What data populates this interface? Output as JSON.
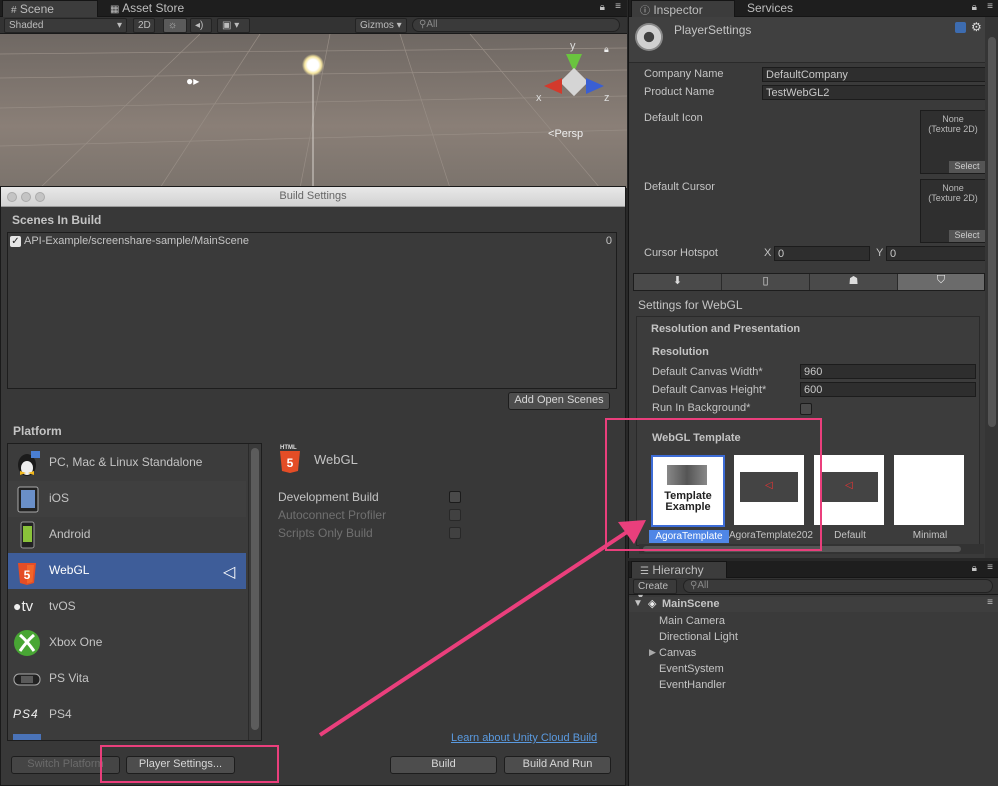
{
  "scene": {
    "tabs": [
      "Scene",
      "Asset Store"
    ],
    "toolbar": {
      "shading": "Shaded",
      "mode_2d": "2D",
      "gizmos": "Gizmos",
      "search_placeholder": "All"
    },
    "persp_label": "Persp",
    "axes": {
      "x": "x",
      "y": "y",
      "z": "z"
    }
  },
  "build_settings": {
    "title": "Build Settings",
    "scenes_header": "Scenes In Build",
    "scenes": [
      {
        "path": "API-Example/screenshare-sample/MainScene",
        "index": "0",
        "checked": true
      }
    ],
    "add_open_scenes": "Add Open Scenes",
    "platform_header": "Platform",
    "platforms": [
      {
        "name": "PC, Mac & Linux Standalone",
        "icon": "penguin-icon"
      },
      {
        "name": "iOS",
        "icon": "ipad-icon"
      },
      {
        "name": "Android",
        "icon": "android-phone-icon"
      },
      {
        "name": "WebGL",
        "icon": "html5-icon",
        "selected": true
      },
      {
        "name": "tvOS",
        "icon": "apple-tv-icon",
        "badge": "tv"
      },
      {
        "name": "Xbox One",
        "icon": "xbox-icon"
      },
      {
        "name": "PS Vita",
        "icon": "ps-vita-icon"
      },
      {
        "name": "PS4",
        "icon": "ps4-icon",
        "badge": "PS4"
      }
    ],
    "selected_platform": "WebGL",
    "html_badge": "HTML",
    "options": [
      {
        "label": "Development Build",
        "enabled": true
      },
      {
        "label": "Autoconnect Profiler",
        "enabled": false
      },
      {
        "label": "Scripts Only Build",
        "enabled": false
      }
    ],
    "cloud_link": "Learn about Unity Cloud Build",
    "switch_platform": "Switch Platform",
    "player_settings": "Player Settings...",
    "build": "Build",
    "build_and_run": "Build And Run"
  },
  "inspector": {
    "tabs": [
      "Inspector",
      "Services"
    ],
    "title": "PlayerSettings",
    "company_label": "Company Name",
    "company_value": "DefaultCompany",
    "product_label": "Product Name",
    "product_value": "TestWebGL2",
    "default_icon_label": "Default Icon",
    "default_cursor_label": "Default Cursor",
    "texture_none": "None",
    "texture_type": "(Texture 2D)",
    "select": "Select",
    "hotspot_label": "Cursor Hotspot",
    "hotspot_x_label": "X",
    "hotspot_x": "0",
    "hotspot_y_label": "Y",
    "hotspot_y": "0",
    "settings_for": "Settings for WebGL",
    "res_section": "Resolution and Presentation",
    "res_sub": "Resolution",
    "canvas_width_label": "Default Canvas Width*",
    "canvas_width": "960",
    "canvas_height_label": "Default Canvas Height*",
    "canvas_height": "600",
    "run_bg_label": "Run In Background*",
    "template_header": "WebGL Template",
    "templates": [
      {
        "name": "AgoraTemplate",
        "preview_text": "Template Example",
        "selected": true
      },
      {
        "name": "AgoraTemplate202"
      },
      {
        "name": "Default"
      },
      {
        "name": "Minimal"
      }
    ]
  },
  "hierarchy": {
    "tab": "Hierarchy",
    "create": "Create",
    "search_placeholder": "All",
    "scene": "MainScene",
    "items": [
      "Main Camera",
      "Directional Light",
      "Canvas",
      "EventSystem",
      "EventHandler"
    ]
  },
  "colors": {
    "highlight": "#ea3f7c",
    "selection": "#3e5d99",
    "link": "#5a9ae0"
  }
}
